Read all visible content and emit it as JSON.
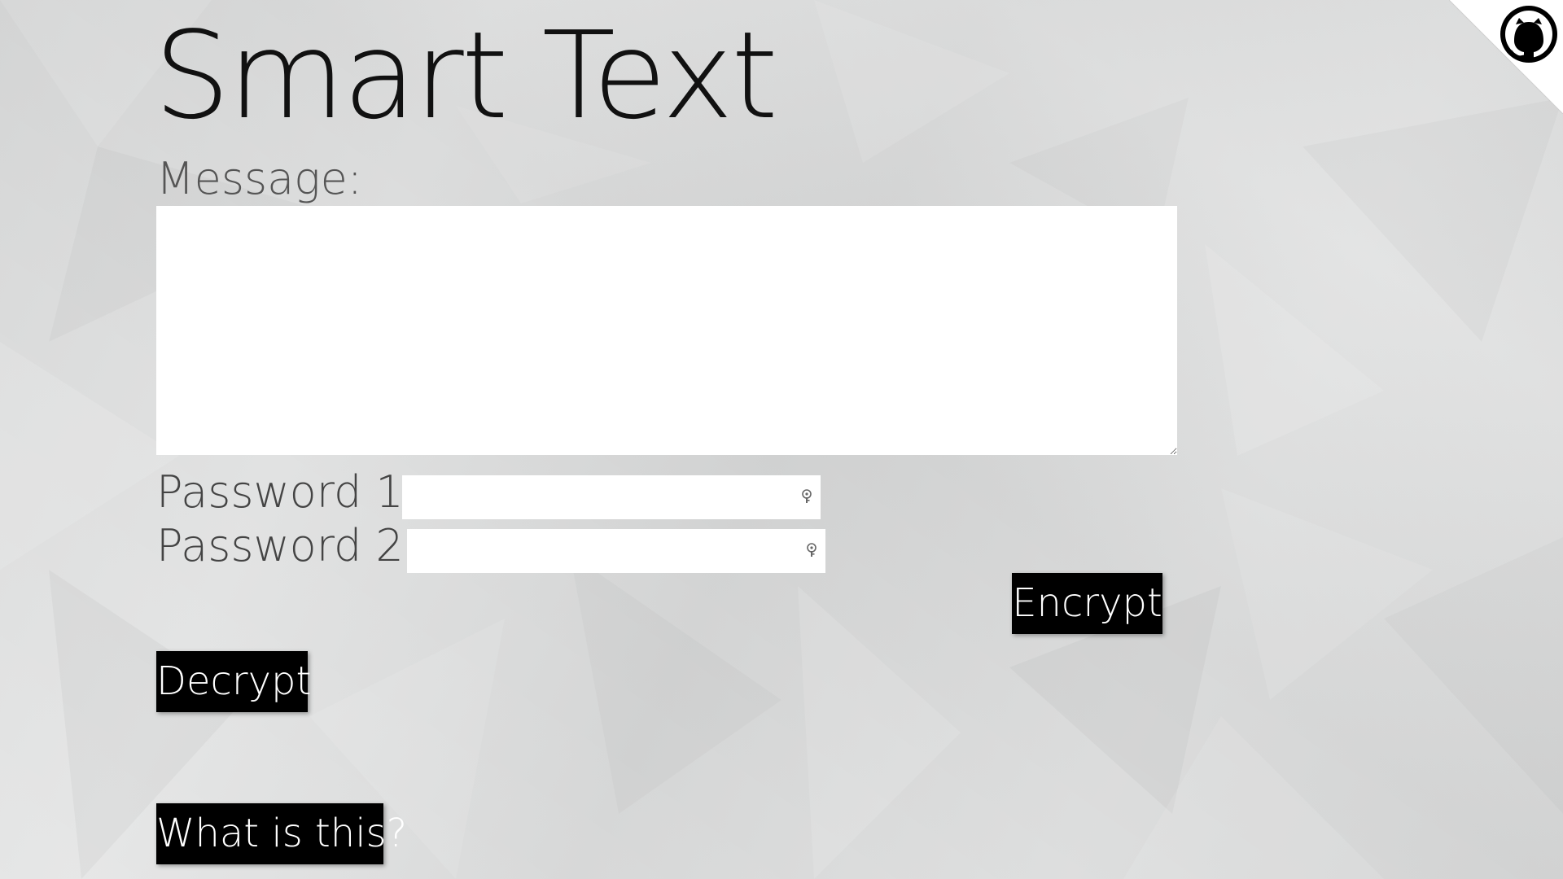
{
  "header": {
    "title": "Smart Text"
  },
  "form": {
    "message_label": "Message:",
    "message_value": "",
    "password1_label": "Password 1:",
    "password1_value": "",
    "password2_label": "Password 2:",
    "password2_value": ""
  },
  "actions": {
    "encrypt_label": "Encrypt",
    "decrypt_label": "Decrypt",
    "about_label": "What is this?"
  },
  "corner": {
    "icon": "github-octocat-icon"
  },
  "colors": {
    "background": "#dcdddd",
    "button": "#000000",
    "button_text": "#ffffff",
    "field": "#ffffff"
  }
}
